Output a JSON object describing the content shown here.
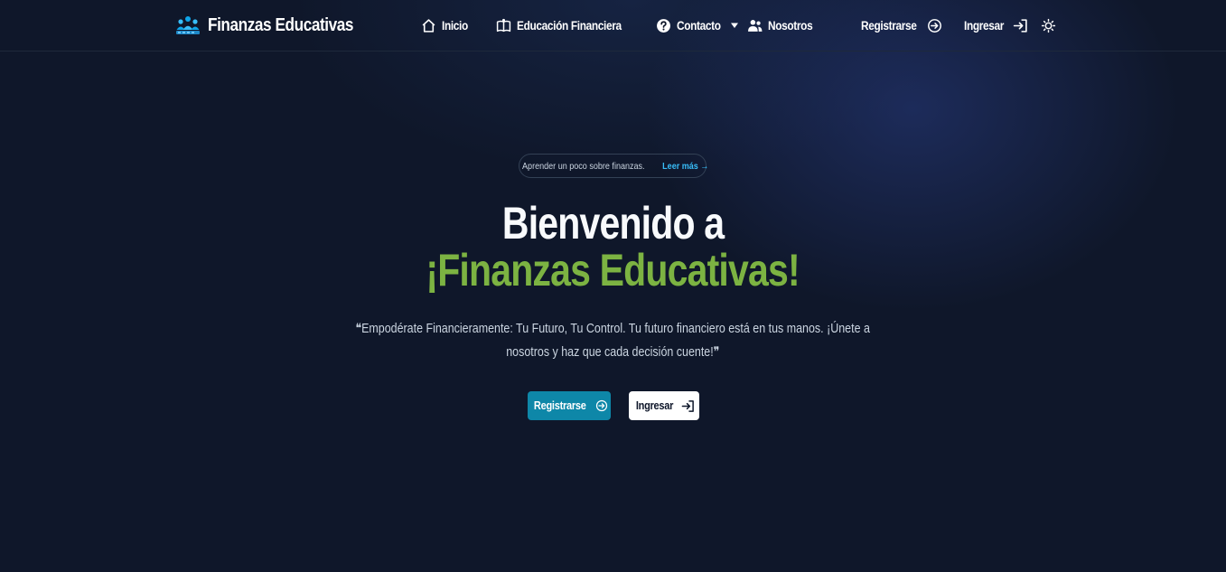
{
  "brand": {
    "name": "Finanzas Educativas",
    "logo_icon": "people-group-icon"
  },
  "nav": {
    "items": [
      {
        "label": "Inicio",
        "icon": "home-icon"
      },
      {
        "label": "Educación Financiera",
        "icon": "book-icon",
        "dropdown": true
      },
      {
        "label": "Contacto",
        "icon": "question-circle-icon"
      },
      {
        "label": "Nosotros",
        "icon": "users-icon"
      }
    ],
    "register_label": "Registrarse",
    "login_label": "Ingresar",
    "theme_icon": "sun-icon"
  },
  "hero": {
    "pill_text": "Aprender un poco sobre finanzas.",
    "pill_link": "Leer más →",
    "title_line1": "Bienvenido a",
    "title_line2": "¡Finanzas Educativas!",
    "quote_line1": "❝Empodérate Financieramente: Tu Futuro, Tu Control. Tu futuro financiero está en tus manos. ¡Únete a",
    "quote_line2": "nosotros y haz que cada decisión cuente!❞",
    "register_button": "Registrarse",
    "login_button": "Ingresar"
  },
  "colors": {
    "background": "#0f172a",
    "accent_green": "#7cb342",
    "primary_button": "#0e87a8",
    "link": "#38bdf8"
  }
}
